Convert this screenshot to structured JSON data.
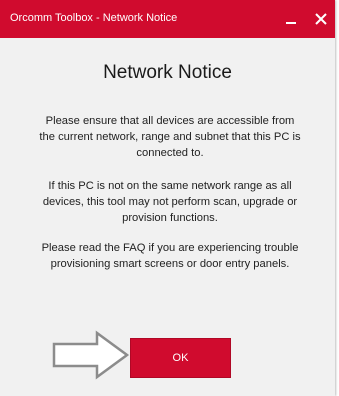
{
  "window": {
    "title": "Orcomm Toolbox - Network Notice"
  },
  "dialog": {
    "heading": "Network Notice",
    "paragraphs": [
      "Please ensure that all devices are accessible from the current network, range and subnet that this PC is connected to.",
      "If this PC is not on the same network range as all devices, this tool may not perform scan, upgrade or provision functions.",
      "Please read the FAQ if you are experiencing trouble provisioning smart screens or door entry panels."
    ],
    "ok_label": "OK"
  },
  "icons": {
    "minimize": "minimize-icon",
    "close": "close-icon",
    "arrow": "arrow-right-icon"
  },
  "colors": {
    "accent": "#d00b2e",
    "background": "#f1f1f1",
    "text": "#222222"
  }
}
